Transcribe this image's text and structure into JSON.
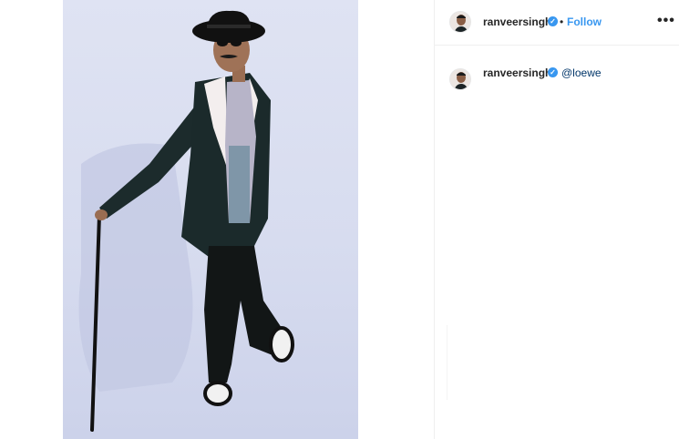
{
  "post": {
    "image_alt": "Man in black hat, sunglasses, dark blazer and patterned shirt posing with a cane",
    "background_color": "#d7dcef"
  },
  "header": {
    "username": "ranveersingh",
    "separator": "•",
    "follow_label": "Follow",
    "more_icon": "more-horizontal-icon",
    "more_label": "•••"
  },
  "comment": {
    "username": "ranveersingh",
    "text": "@loewe"
  },
  "colors": {
    "link": "#3897f0",
    "mention": "#003569",
    "text": "#262626"
  }
}
